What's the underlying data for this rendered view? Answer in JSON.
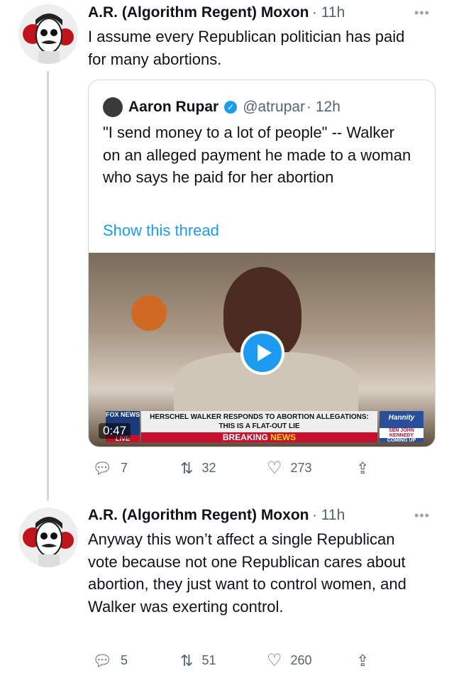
{
  "tweets": [
    {
      "author": "A.R. (Algorithm Regent) Moxon",
      "time": "· 11h",
      "text": "I assume every Republican politician has paid for many abortions.",
      "quote": {
        "author": "Aaron Rupar",
        "handle": "@atrupar",
        "time": "· 12h",
        "text": "\"I send money to a lot of people\" -- Walker on an alleged payment he made to a woman who says he paid for her abortion",
        "link": "Show this thread",
        "video": {
          "duration": "0:47",
          "chyron_line1": "HERSCHEL WALKER RESPONDS TO ABORTION ALLEGATIONS:",
          "chyron_line2": "THIS IS A FLAT-OUT LIE",
          "breaking": "BREAKING",
          "news": "NEWS",
          "network": "FOX NEWS",
          "live": "LIVE",
          "show": "Hannity",
          "upnext": "SEN JOHN KENNEDY",
          "coming": "COMING UP"
        }
      },
      "replies": "7",
      "retweets": "32",
      "likes": "273"
    },
    {
      "author": "A.R. (Algorithm Regent) Moxon",
      "time": "· 11h",
      "text": "Anyway this won’t affect a single Republican vote because not one Republican cares about abortion, they just want to control women, and Walker was exerting control.",
      "replies": "5",
      "retweets": "51",
      "likes": "260"
    }
  ],
  "colors": {
    "link": "#1d9bf0",
    "verified": "#1d9bf0",
    "muted": "#536471"
  }
}
